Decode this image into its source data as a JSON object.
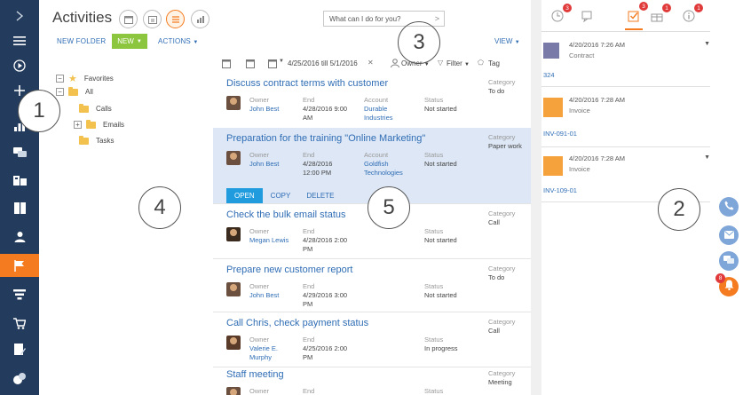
{
  "header": {
    "title": "Activities",
    "search_placeholder": "What can I do for you?"
  },
  "toolbar": {
    "new_folder": "NEW FOLDER",
    "new_label": "NEW",
    "actions_label": "ACTIONS",
    "view_label": "VIEW"
  },
  "filters": {
    "date_range": "4/25/2016 till 5/1/2016",
    "owner": "Owner",
    "filter": "Filter",
    "tag": "Tag"
  },
  "tree": {
    "favorites": "Favorites",
    "all": "All",
    "calls": "Calls",
    "emails": "Emails",
    "tasks": "Tasks"
  },
  "labels": {
    "owner": "Owner",
    "end": "End",
    "account": "Account",
    "status": "Status",
    "category": "Category"
  },
  "activities": [
    {
      "title": "Discuss contract terms with customer",
      "owner": "John Best",
      "end": [
        "4/28/2016 9:00",
        "AM"
      ],
      "account": [
        "Durable",
        "Industries"
      ],
      "status": "Not started",
      "category": "To do"
    },
    {
      "title": "Preparation for the training \"Online Marketing\"",
      "owner": "John Best",
      "end": [
        "4/28/2016",
        "12:00 PM"
      ],
      "account": [
        "Goldfish",
        "Technologies"
      ],
      "status": "Not started",
      "category": "Paper work"
    },
    {
      "title": "Check the bulk email status",
      "owner": "Megan Lewis",
      "end": [
        "4/28/2016 2:00",
        "PM"
      ],
      "account": [],
      "status": "Not started",
      "category": "Call"
    },
    {
      "title": "Prepare new customer report",
      "owner": "John Best",
      "end": [
        "4/29/2016 3:00",
        "PM"
      ],
      "account": [],
      "status": "Not started",
      "category": "To do"
    },
    {
      "title": "Call Chris, check payment status",
      "owner": [
        "Valerie E.",
        "Murphy"
      ],
      "end": [
        "4/25/2016 2:00",
        "PM"
      ],
      "account": [],
      "status": "In progress",
      "category": "Call"
    },
    {
      "title": "Staff meeting",
      "owner": "",
      "end": [],
      "account": [],
      "status": "",
      "category": "Meeting"
    }
  ],
  "row_actions": {
    "open": "OPEN",
    "copy": "COPY",
    "delete": "DELETE"
  },
  "right_panel": {
    "tab_badges": [
      "3",
      "",
      "3",
      "1",
      "1"
    ],
    "feed": [
      {
        "date": "4/20/2016 7:26 AM",
        "type": "Contract",
        "number": "324"
      },
      {
        "date": "4/20/2016 7:28 AM",
        "type": "Invoice",
        "number": "INV-091-01"
      },
      {
        "date": "4/20/2016 7:28 AM",
        "type": "Invoice",
        "number": "INV-109-01"
      }
    ]
  },
  "comm_panel": {
    "notification_badge": "8"
  },
  "callouts": [
    "1",
    "2",
    "3",
    "4",
    "5"
  ],
  "colors": {
    "nav_bg": "#233b5c",
    "accent": "#f47b20",
    "link": "#2f6db5",
    "new_button": "#8cc63f",
    "open_button": "#1f9bde",
    "badge": "#e03a3a"
  }
}
